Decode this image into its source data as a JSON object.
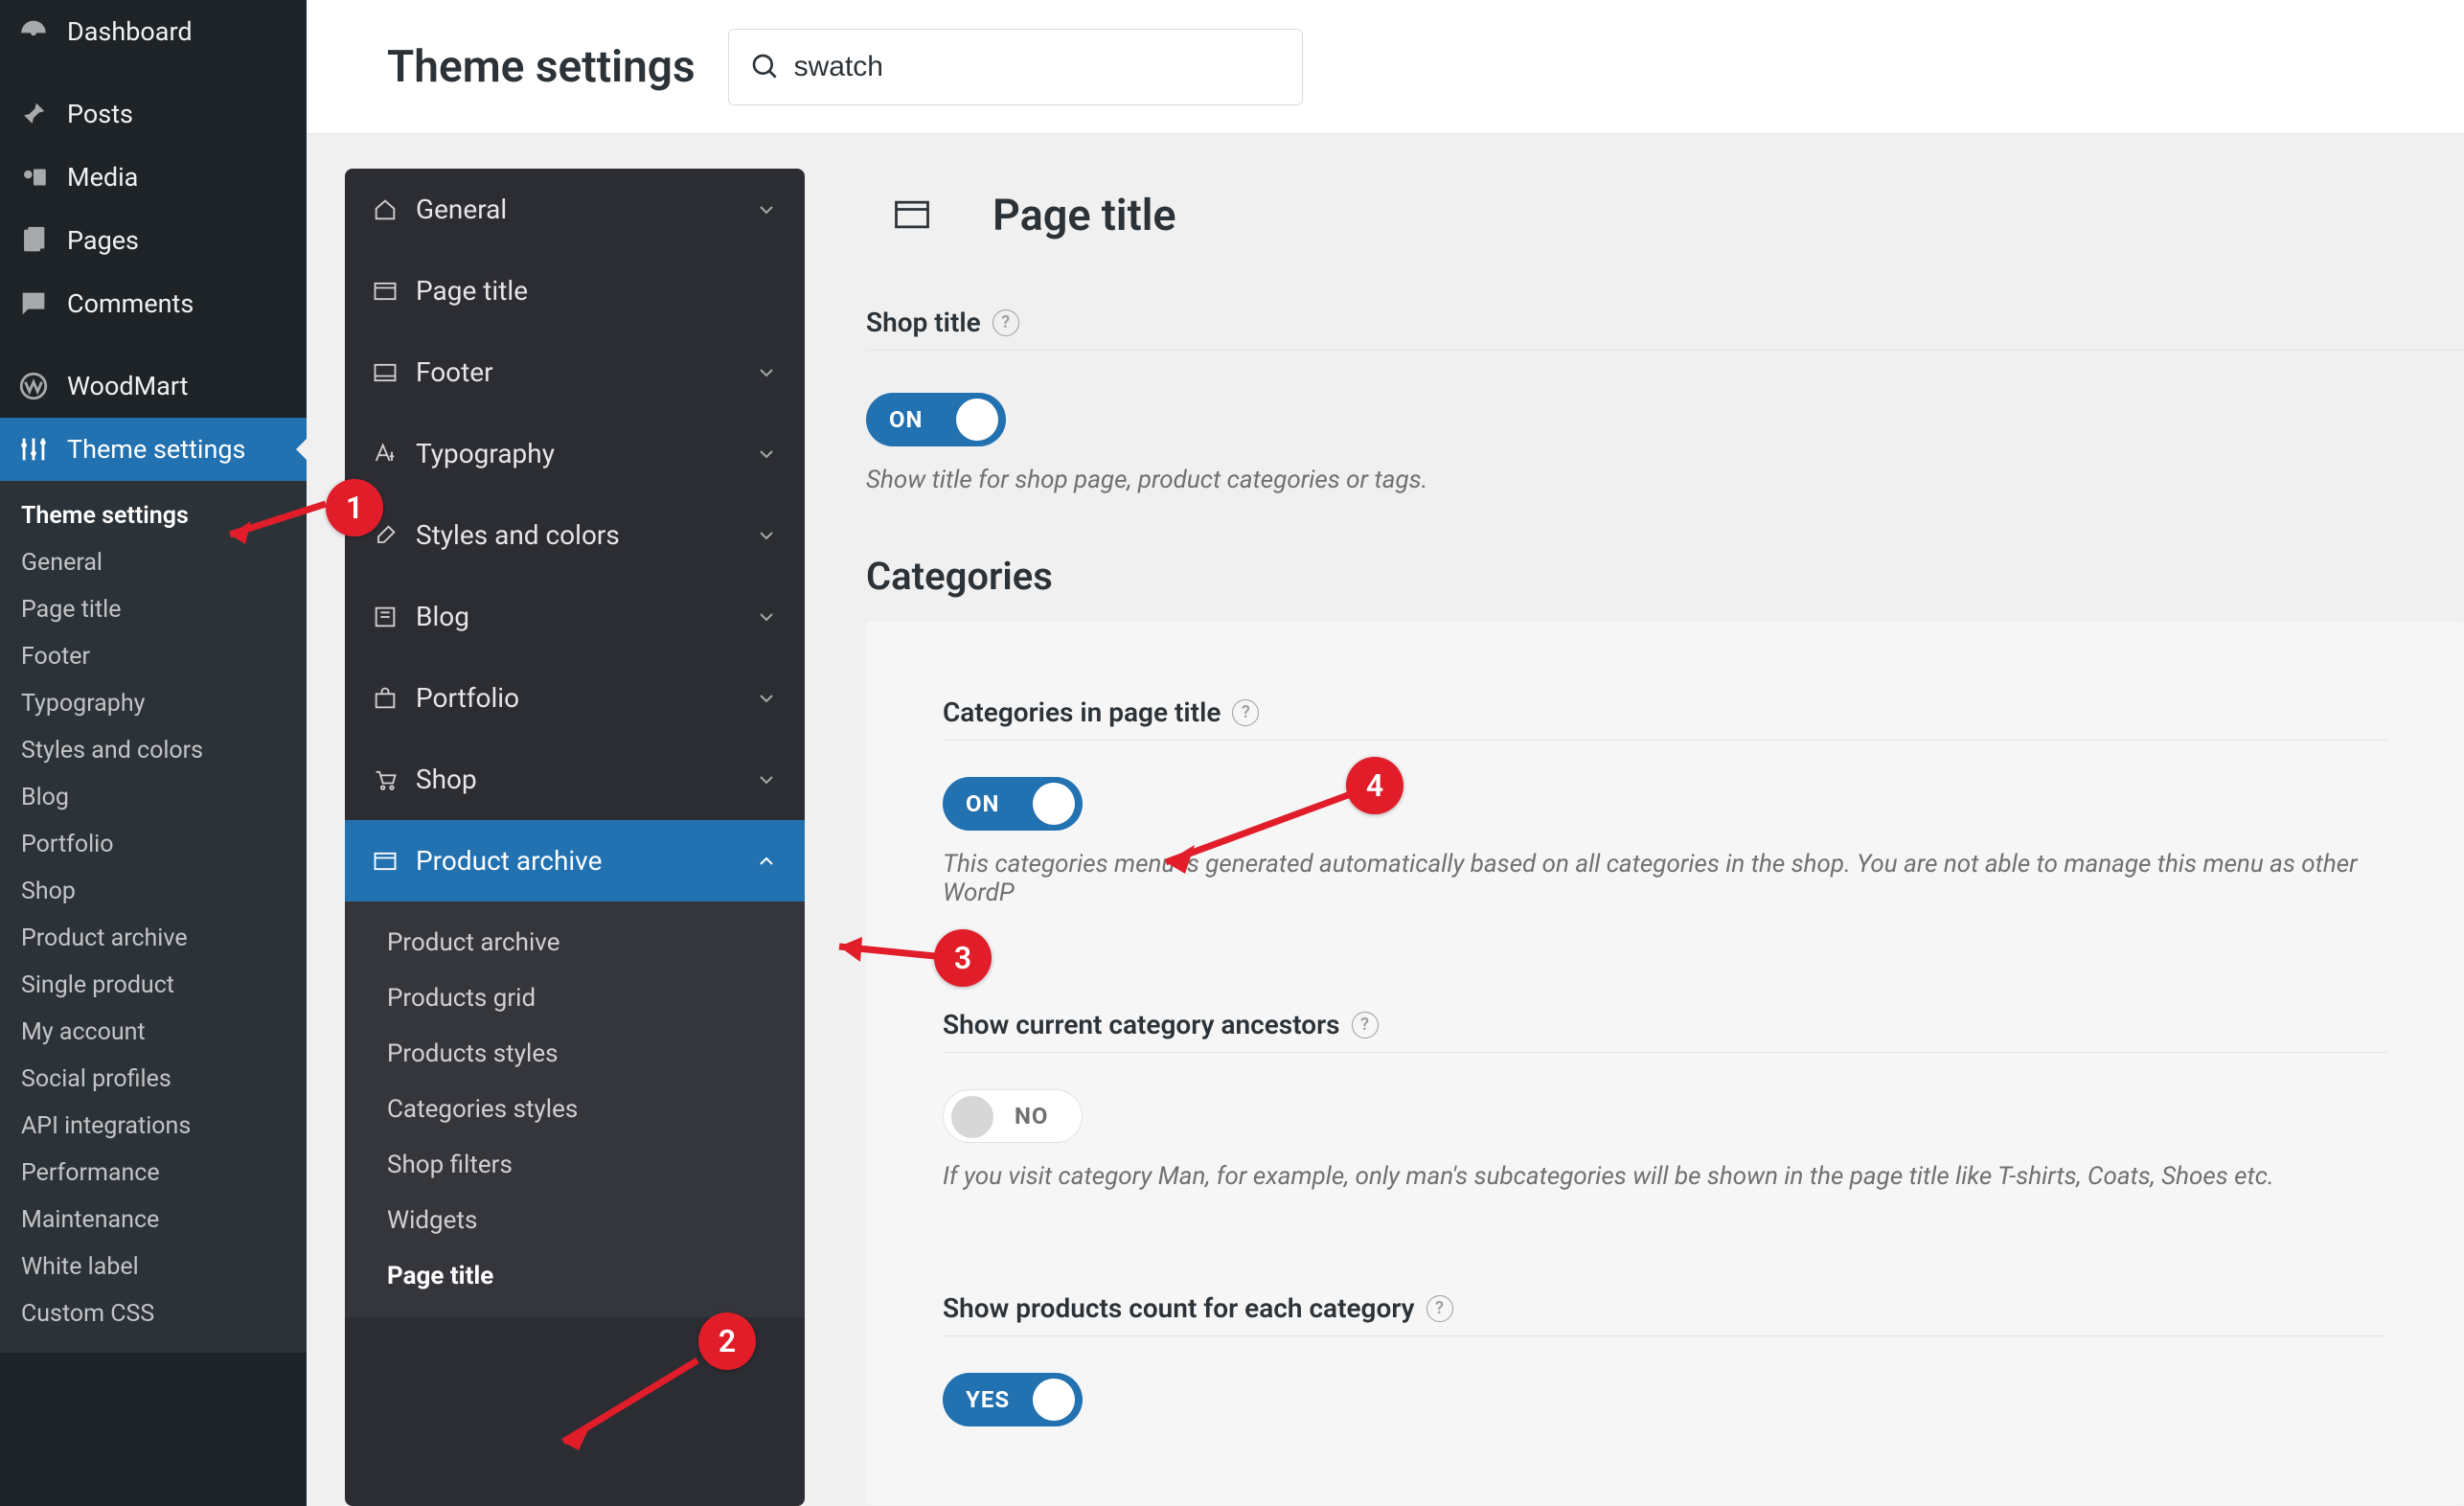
{
  "wp_sidebar": {
    "items": [
      {
        "label": "Dashboard"
      },
      {
        "label": "Posts"
      },
      {
        "label": "Media"
      },
      {
        "label": "Pages"
      },
      {
        "label": "Comments"
      },
      {
        "label": "WoodMart"
      },
      {
        "label": "Theme settings"
      }
    ],
    "submenu": {
      "items": [
        "Theme settings",
        "General",
        "Page title",
        "Footer",
        "Typography",
        "Styles and colors",
        "Blog",
        "Portfolio",
        "Shop",
        "Product archive",
        "Single product",
        "My account",
        "Social profiles",
        "API integrations",
        "Performance",
        "Maintenance",
        "White label",
        "Custom CSS"
      ]
    }
  },
  "topbar": {
    "title": "Theme settings",
    "search_value": "swatch"
  },
  "ts_sidebar": {
    "items": [
      {
        "label": "General",
        "expandable": true
      },
      {
        "label": "Page title",
        "expandable": false
      },
      {
        "label": "Footer",
        "expandable": true
      },
      {
        "label": "Typography",
        "expandable": true
      },
      {
        "label": "Styles and colors",
        "expandable": true
      },
      {
        "label": "Blog",
        "expandable": true
      },
      {
        "label": "Portfolio",
        "expandable": true
      },
      {
        "label": "Shop",
        "expandable": true
      },
      {
        "label": "Product archive",
        "expandable": true,
        "active": true
      }
    ],
    "submenu": {
      "items": [
        "Product archive",
        "Products grid",
        "Products styles",
        "Categories styles",
        "Shop filters",
        "Widgets",
        "Page title"
      ]
    }
  },
  "pane": {
    "title": "Page title",
    "shop_title": {
      "label": "Shop title",
      "toggle_label": "ON",
      "desc": "Show title for shop page, product categories or tags."
    },
    "categories_title": "Categories",
    "categories_in_page_title": {
      "label": "Categories in page title",
      "toggle_label": "ON",
      "desc": "This categories menu is generated automatically based on all categories in the shop. You are not able to manage this menu as other WordP"
    },
    "ancestors": {
      "label": "Show current category ancestors",
      "toggle_label": "NO",
      "desc": "If you visit category Man, for example, only man's subcategories will be shown in the page title like T-shirts, Coats, Shoes etc."
    },
    "products_count": {
      "label": "Show products count for each category",
      "toggle_label": "YES"
    }
  },
  "annotations": {
    "n1": "1",
    "n2": "2",
    "n3": "3",
    "n4": "4"
  }
}
